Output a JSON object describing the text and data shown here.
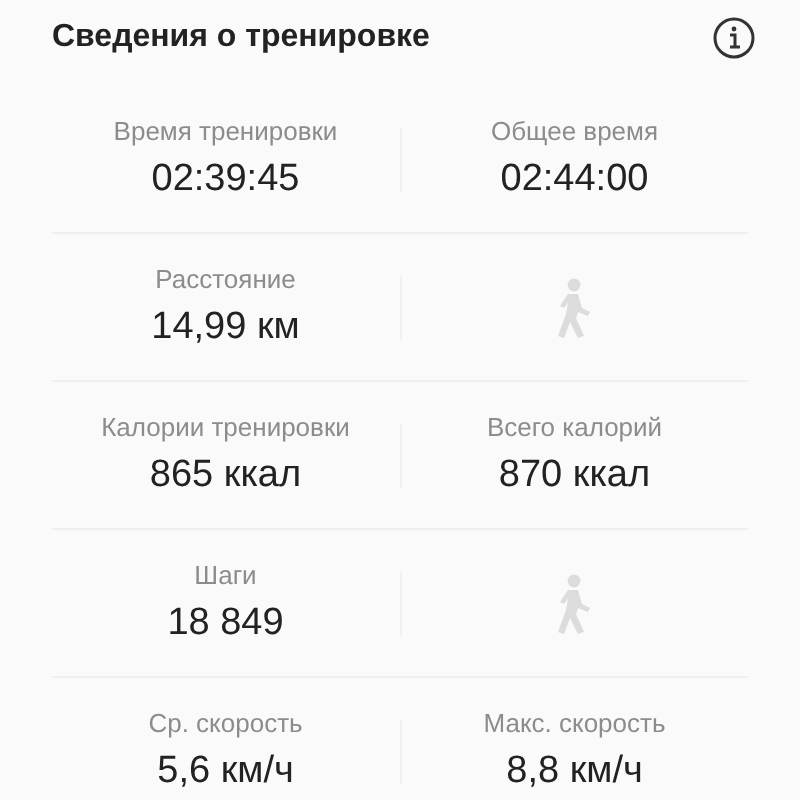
{
  "header": {
    "title": "Сведения о тренировке"
  },
  "rows": [
    {
      "cells": [
        {
          "kind": "metric",
          "label": "Время тренировки",
          "value": "02:39:45"
        },
        {
          "kind": "metric",
          "label": "Общее время",
          "value": "02:44:00"
        }
      ]
    },
    {
      "cells": [
        {
          "kind": "metric",
          "label": "Расстояние",
          "value": "14,99 км"
        },
        {
          "kind": "walker"
        }
      ]
    },
    {
      "cells": [
        {
          "kind": "metric",
          "label": "Калории тренировки",
          "value": "865 ккал"
        },
        {
          "kind": "metric",
          "label": "Всего калорий",
          "value": "870 ккал"
        }
      ]
    },
    {
      "cells": [
        {
          "kind": "metric",
          "label": "Шаги",
          "value": "18 849"
        },
        {
          "kind": "walker"
        }
      ]
    },
    {
      "cells": [
        {
          "kind": "metric",
          "label": "Ср. скорость",
          "value": "5,6 км/ч"
        },
        {
          "kind": "metric",
          "label": "Макс. скорость",
          "value": "8,8 км/ч"
        }
      ]
    }
  ]
}
